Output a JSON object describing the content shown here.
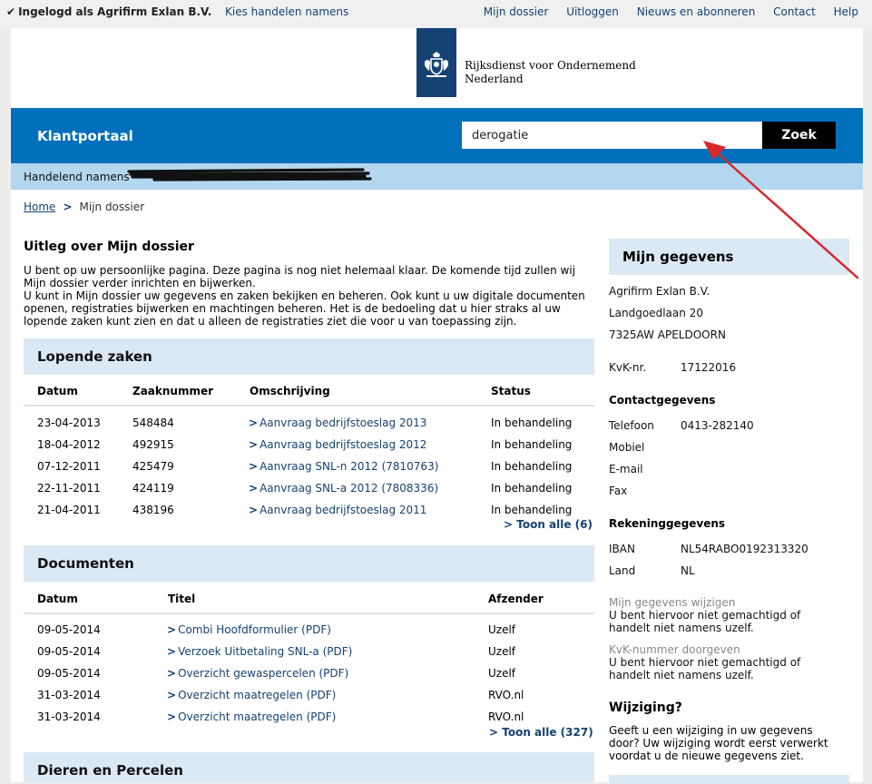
{
  "topbar": {
    "login_text": "Ingelogd als Agrifirm Exlan B.V.",
    "kies_link": "Kies handelen namens",
    "nav": [
      "Mijn dossier",
      "Uitloggen",
      "Nieuws en abonneren",
      "Contact",
      "Help"
    ]
  },
  "logo": {
    "line1": "Rijksdienst voor Ondernemend",
    "line2": "Nederland"
  },
  "header": {
    "portal_title": "Klantportaal",
    "search_value": "derogatie",
    "search_button": "Zoek",
    "handelend": "Handelend namens"
  },
  "breadcrumb": {
    "home": "Home",
    "current": "Mijn dossier"
  },
  "intro": {
    "heading": "Uitleg over Mijn dossier",
    "p1": "U bent op uw persoonlijke pagina. Deze pagina is nog niet helemaal klaar. De komende tijd zullen wij Mijn dossier verder inrichten en bijwerken.",
    "p2": "U kunt in Mijn dossier uw gegevens en zaken bekijken en beheren. Ook kunt u uw digitale documenten openen, registraties bijwerken en machtingen beheren. Het is de bedoeling dat u hier straks al uw lopende zaken kunt zien en dat u alleen de registraties ziet die voor u van toepassing zijn."
  },
  "zaken": {
    "title": "Lopende zaken",
    "headers": [
      "Datum",
      "Zaaknummer",
      "Omschrijving",
      "Status"
    ],
    "rows": [
      [
        "23-04-2013",
        "548484",
        "Aanvraag bedrijfstoeslag 2013",
        "In behandeling"
      ],
      [
        "18-04-2012",
        "492915",
        "Aanvraag bedrijfstoeslag 2012",
        "In behandeling"
      ],
      [
        "07-12-2011",
        "425479",
        "Aanvraag SNL-n 2012 (7810763)",
        "In behandeling"
      ],
      [
        "22-11-2011",
        "424119",
        "Aanvraag SNL-a 2012 (7808336)",
        "In behandeling"
      ],
      [
        "21-04-2011",
        "438196",
        "Aanvraag bedrijfstoeslag 2011",
        "In behandeling"
      ]
    ],
    "toon_alle": "Toon alle (6)"
  },
  "documenten": {
    "title": "Documenten",
    "headers": [
      "Datum",
      "Titel",
      "Afzender"
    ],
    "rows": [
      [
        "09-05-2014",
        "Combi Hoofdformulier (PDF)",
        "Uzelf"
      ],
      [
        "09-05-2014",
        "Verzoek Uitbetaling SNL-a (PDF)",
        "Uzelf"
      ],
      [
        "09-05-2014",
        "Overzicht gewaspercelen (PDF)",
        "Uzelf"
      ],
      [
        "31-03-2014",
        "Overzicht maatregelen (PDF)",
        "RVO.nl"
      ],
      [
        "31-03-2014",
        "Overzicht maatregelen (PDF)",
        "RVO.nl"
      ]
    ],
    "toon_alle": "Toon alle (327)"
  },
  "dieren": {
    "title": "Dieren en Percelen"
  },
  "gegevens": {
    "title": "Mijn gegevens",
    "name": "Agrifirm Exlan B.V.",
    "street": "Landgoedlaan 20",
    "city": "7325AW APELDOORN",
    "kvk_label": "KvK-nr.",
    "kvk_value": "17122016",
    "contact_heading": "Contactgegevens",
    "telefoon_label": "Telefoon",
    "telefoon_value": "0413-282140",
    "mobiel_label": "Mobiel",
    "email_label": "E-mail",
    "fax_label": "Fax",
    "rekening_heading": "Rekeninggegevens",
    "iban_label": "IBAN",
    "iban_value": "NL54RABO0192313320",
    "land_label": "Land",
    "land_value": "NL",
    "wijzigen_link": "Mijn gegevens wijzigen",
    "wijzigen_note": "U bent hiervoor niet gemachtigd of handelt niet namens uzelf.",
    "kvk_doorgeven": "KvK-nummer doorgeven",
    "kvk_note": "U bent hiervoor niet gemachtigd of handelt niet namens uzelf.",
    "wijziging_heading": "Wijziging?",
    "wijziging_text": "Geeft u een wijziging in uw gegevens door? Uw wijziging wordt eerst verwerkt voordat u de nieuwe gegevens ziet."
  },
  "colors": {
    "brand_blue": "#0070bc",
    "light_blue": "#b3d7ee",
    "panel_blue": "#dbe9f4",
    "link": "#154273",
    "annotation_red": "#d9282b"
  }
}
